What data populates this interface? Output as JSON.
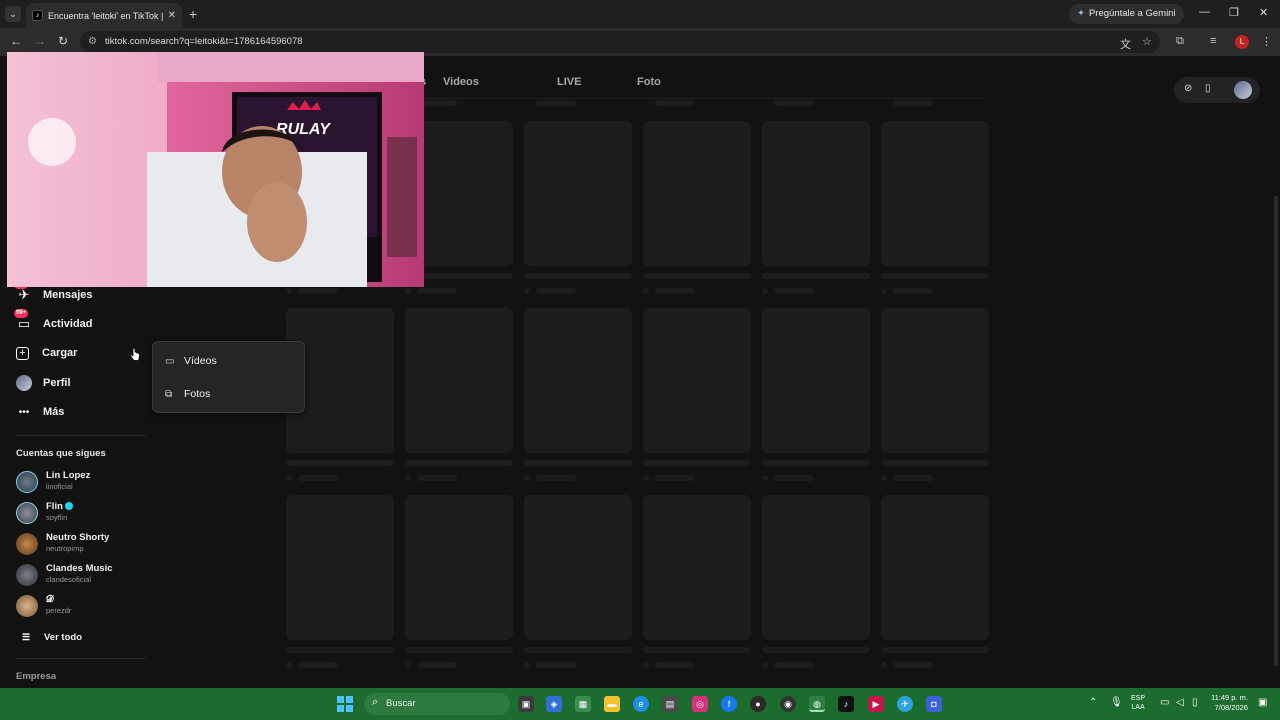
{
  "browser": {
    "tab_title": "Encuentra 'leitoki' en TikTok | B",
    "gemini_label": "Pregúntale a Gemini",
    "url": "tiktok.com/search?q=leitoki&t=1786164596078",
    "profile_initial": "L"
  },
  "topnav": {
    "tabs": [
      "s",
      "Videos",
      "LIVE",
      "Foto"
    ]
  },
  "sidebar": {
    "items": [
      {
        "label": "Mensajes",
        "badge": "99+",
        "icon": "paper-plane-icon"
      },
      {
        "label": "Actividad",
        "badge": "99+",
        "icon": "inbox-icon"
      },
      {
        "label": "Cargar",
        "icon": "plus-square-icon"
      },
      {
        "label": "Perfil",
        "icon": "avatar"
      },
      {
        "label": "Más",
        "icon": "more-icon"
      }
    ],
    "following_title": "Cuentas que sigues",
    "accounts": [
      {
        "name": "Lin Lopez",
        "handle": "linoficial"
      },
      {
        "name": "Flin",
        "handle": "soyflin"
      },
      {
        "name": "Neutro Shorty",
        "handle": "neutropimp"
      },
      {
        "name": "Clandes Music",
        "handle": "clandesoficial"
      },
      {
        "name": "𝓓",
        "handle": "perezdr"
      }
    ],
    "see_all": "Ver todo",
    "footer": "Empresa"
  },
  "upload_menu": {
    "items": [
      {
        "label": "Vídeos",
        "icon": "video-camera-icon"
      },
      {
        "label": "Fotos",
        "icon": "photos-icon"
      }
    ]
  },
  "webcam": {
    "sign_text": "RULAY"
  },
  "taskbar": {
    "search_label": "Buscar",
    "lang_top": "ESP",
    "lang_bottom": "LAA",
    "time": "11:49 p. m.",
    "date": "7/08/2026"
  },
  "colors": {
    "page_bg": "#121212",
    "badge": "#fe2c55",
    "taskbar": "#1c6b2f"
  }
}
